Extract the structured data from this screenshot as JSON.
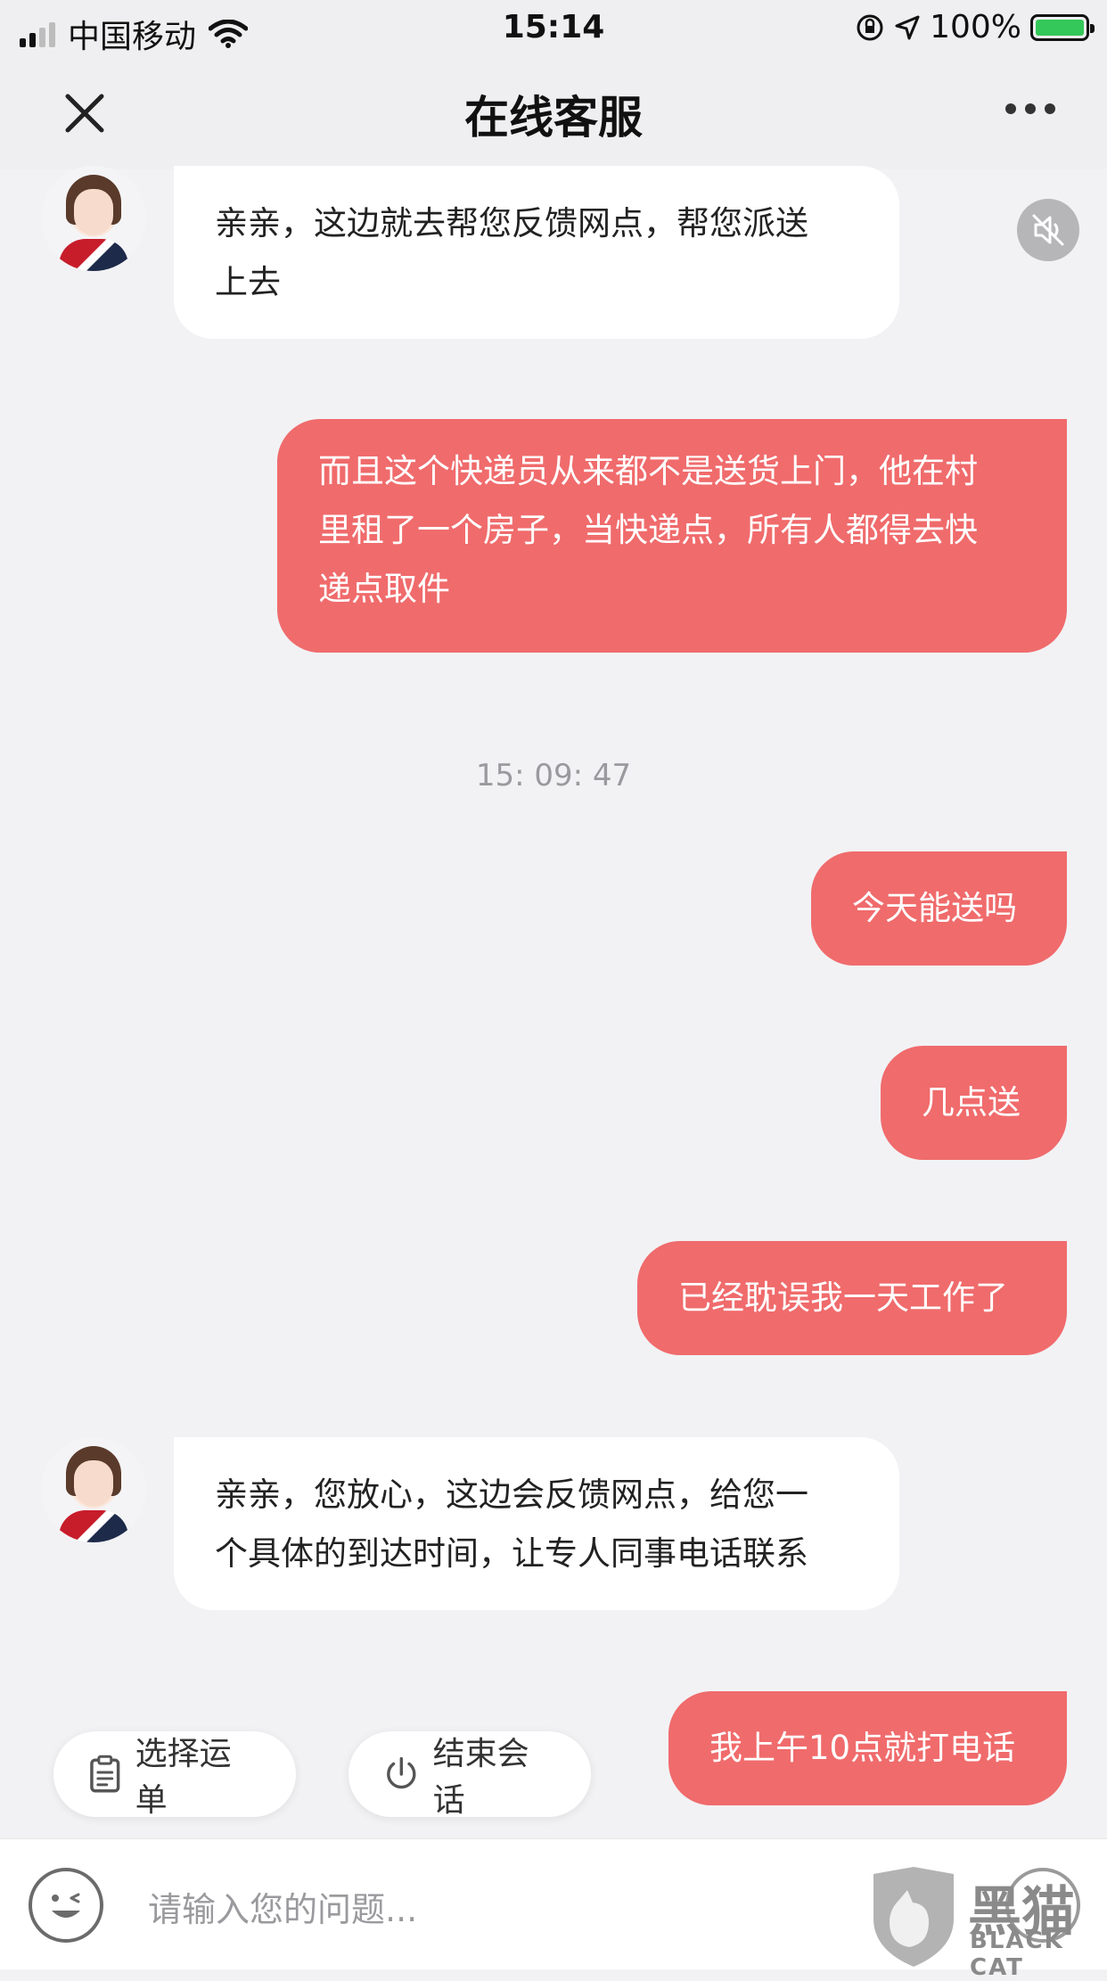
{
  "status_bar": {
    "carrier": "中国移动",
    "time": "15:14",
    "battery": "100%"
  },
  "nav": {
    "title": "在线客服"
  },
  "messages": [
    {
      "role": "agent",
      "text": "亲亲，这边就去帮您反馈网点，帮您派送\n上去"
    },
    {
      "role": "user",
      "text": "而且这个快递员从来都不是送货上门，他在村\n里租了一个房子，当快递点，所有人都得去快\n递点取件"
    },
    {
      "role": "timestamp",
      "text": "15: 09: 47"
    },
    {
      "role": "user",
      "text": "今天能送吗"
    },
    {
      "role": "user",
      "text": "几点送"
    },
    {
      "role": "user",
      "text": "已经耽误我一天工作了"
    },
    {
      "role": "agent",
      "text": "亲亲，您放心，这边会反馈网点，给您一\n个具体的到达时间，让专人同事电话联系"
    },
    {
      "role": "user",
      "text": "我上午10点就打电话"
    }
  ],
  "quick_actions": {
    "select_waybill": "选择运单",
    "end_session": "结束会话"
  },
  "input": {
    "placeholder": "请输入您的问题..."
  },
  "watermark": {
    "brand_cn": "黑猫",
    "brand_en": "BLACK CAT"
  },
  "colors": {
    "user_bubble": "#f06b6c",
    "agent_bubble": "#ffffff",
    "background": "#f2f2f4"
  }
}
